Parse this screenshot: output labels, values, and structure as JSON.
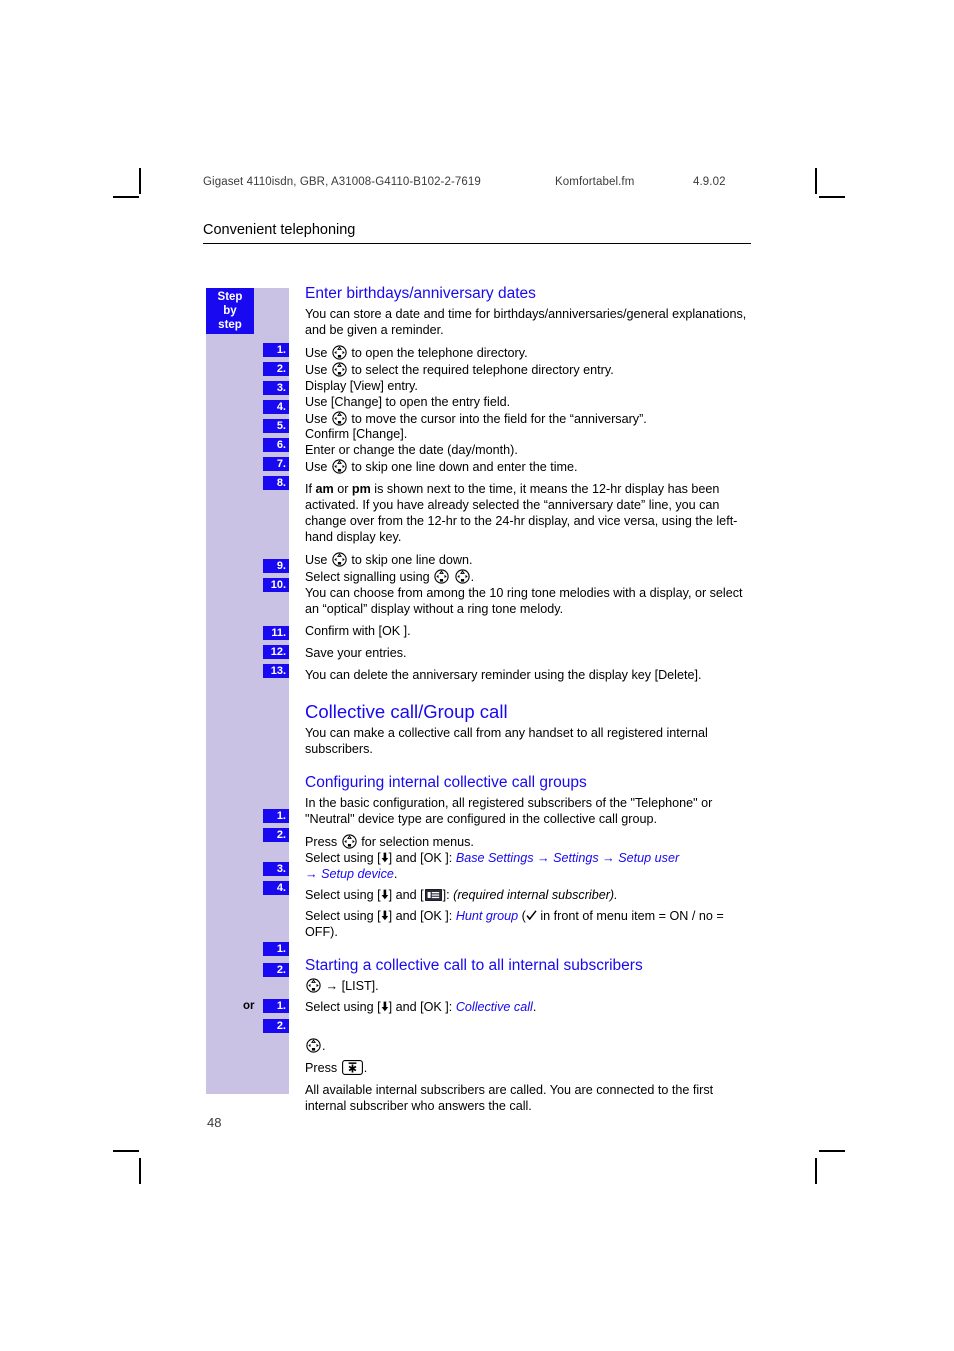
{
  "crop_marks": true,
  "doc_header": {
    "left": "Gigaset 4110isdn, GBR, A31008-G4110-B102-2-7619",
    "file": "Komfortabel.fm",
    "date": "4.9.02"
  },
  "running_title": "Convenient telephoning",
  "page_number": "48",
  "rail": {
    "label_line1": "Step",
    "label_line2": "by",
    "label_line3": "step",
    "or_label": "or",
    "badges": [
      "1.",
      "2.",
      "3.",
      "4.",
      "5.",
      "6.",
      "7.",
      "8.",
      "9.",
      "10.",
      "11.",
      "12.",
      "13."
    ]
  },
  "colors": {
    "accent_blue": "#1809f0",
    "rail_lavender": "#c9c2e4",
    "text_black": "#000000"
  },
  "sections": {
    "birthdays": {
      "heading": "Enter birthdays/anniversary dates",
      "intro": "You can store a date and time for birthdays/anniversaries/general explanations, and be given a reminder.",
      "steps": [
        {
          "n": "1.",
          "pre": "Use ",
          "icon": "nav-key-icon",
          "post": " to open the telephone directory."
        },
        {
          "n": "2.",
          "pre": "Use ",
          "icon": "nav-key-icon",
          "post": " to select the required telephone directory entry."
        },
        {
          "n": "3.",
          "pre": "Display [View] entry.",
          "icon": "",
          "post": ""
        },
        {
          "n": "4.",
          "pre": "Use [Change] to open the entry field.",
          "icon": "",
          "post": ""
        },
        {
          "n": "5.",
          "pre": "Use ",
          "icon": "nav-key-icon",
          "post": " to move the cursor into the field for the “anniversary”."
        },
        {
          "n": "6.",
          "pre": "Confirm [Change].",
          "icon": "",
          "post": ""
        },
        {
          "n": "7.",
          "pre": "Enter or change the date (day/month).",
          "icon": "",
          "post": ""
        },
        {
          "n": "8.",
          "pre": "Use ",
          "icon": "nav-key-icon",
          "post": " to skip one line down and enter the time."
        }
      ],
      "ampm_note_1": "If ",
      "ampm_bold_1": "am",
      "ampm_note_2": " or ",
      "ampm_bold_2": "pm",
      "ampm_note_3": " is shown next to the time, it means the 12-hr display has been activated. If you have already selected the “anniversary date” line, you can change over from the 12-hr to the 24-hr display, and vice versa, using the left-hand display key.",
      "step9_pre": "Use ",
      "step9_post": " to skip one line down.",
      "step10_pre": "Select signalling using ",
      "step10_post": ".",
      "step10_note": "You can choose from among the 10 ring tone melodies with a display, or select an “optical” display without a ring tone melody.",
      "step11": "Confirm with [OK ].",
      "step12": "Save your entries.",
      "step13": "You can delete the anniversary reminder using the display key [Delete]."
    },
    "collective": {
      "heading": "Collective call/Group call",
      "intro": "You can make a collective call from any handset to all registered internal subscribers."
    },
    "configuring": {
      "heading": "Configuring internal collective call groups",
      "intro": "In the basic configuration, all registered subscribers of the \"Telephone\" or \"Neutral\" device type are configured in the collective call group.",
      "step1_pre": "Press ",
      "step1_post": " for selection menus.",
      "step2_pre": "Select using [",
      "step2_mid": "] and [OK ]: ",
      "step2_menu1": "Base Settings",
      "step2_menu2": "Settings",
      "step2_menu3": "Setup user",
      "step2_menu4": "Setup device",
      "step2_end": ".",
      "step3_pre": "Select using [",
      "step3_mid": "] and [",
      "step3_post": "]: ",
      "step3_italic": "(required internal subscriber).",
      "step4_pre": "Select using [",
      "step4_mid": "] and [OK ]: ",
      "step4_menu": "Hunt group",
      "step4_paren_open": " (",
      "step4_tail": " in front of menu item = ON / no = OFF)."
    },
    "starting": {
      "heading": "Starting a collective call to all internal subscribers",
      "step1_post": " → [LIST].",
      "step2_pre": "Select using [",
      "step2_mid": "] and [OK ]: ",
      "step2_menu": "Collective call",
      "step2_end": ".",
      "alt_step1_post": ".",
      "alt_step2_pre": "Press ",
      "alt_step2_post": ".",
      "closing": "All available internal subscribers are called. You are connected to the first internal subscriber who answers the call."
    }
  }
}
